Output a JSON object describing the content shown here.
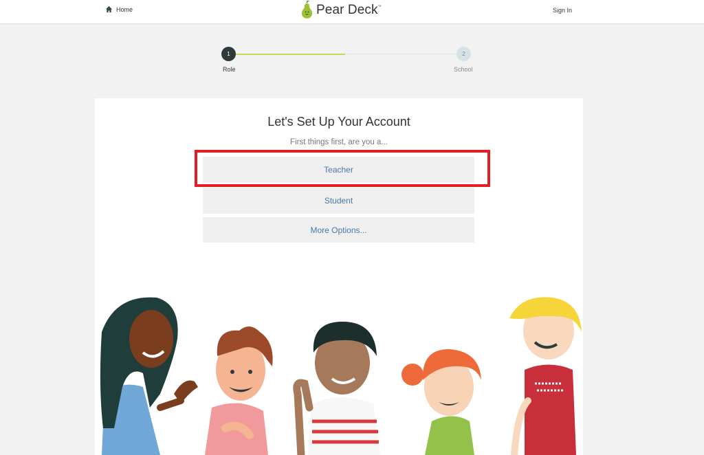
{
  "header": {
    "home_label": "Home",
    "logo_text": "Pear Deck",
    "logo_tm": "™",
    "signin_label": "Sign In"
  },
  "stepper": {
    "steps": [
      {
        "number": "1",
        "label": "Role",
        "active": true
      },
      {
        "number": "2",
        "label": "School",
        "active": false
      }
    ],
    "accent": "#c5d85c"
  },
  "main": {
    "title": "Let's Set Up Your Account",
    "subtitle": "First things first, are you a...",
    "options": [
      {
        "label": "Teacher",
        "highlighted": true
      },
      {
        "label": "Student",
        "highlighted": false
      },
      {
        "label": "More Options...",
        "highlighted": false
      }
    ]
  },
  "colors": {
    "highlight": "#e51d24",
    "link": "#4778a8",
    "button_bg": "#efefef"
  }
}
